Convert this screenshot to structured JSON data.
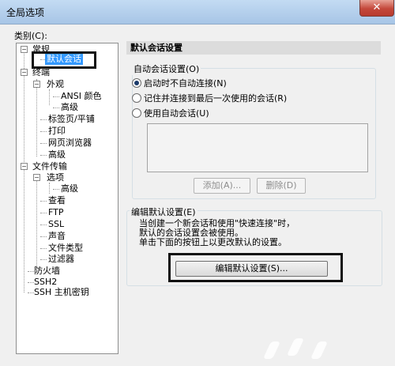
{
  "window": {
    "title": "全局选项",
    "close": "✕"
  },
  "category_label": "类别(C):",
  "tree": {
    "general": "常规",
    "default_session": "默认会话",
    "terminal": "终端",
    "appearance": "外观",
    "ansi_color": "ANSI 颜色",
    "advanced_1": "高级",
    "tabs": "标签页/平铺",
    "print": "打印",
    "web_browser": "网页浏览器",
    "advanced_2": "高级",
    "file_transfer": "文件传输",
    "options": "选项",
    "advanced_3": "高级",
    "view": "查看",
    "ftp": "FTP",
    "ssl": "SSL",
    "sound": "声音",
    "file_type": "文件类型",
    "filter": "过滤器",
    "firewall": "防火墙",
    "ssh2": "SSH2",
    "ssh_host_key": "SSH 主机密钥",
    "expanded_symbol": "−"
  },
  "panel": {
    "header": "默认会话设置",
    "auto_session": {
      "title": "自动会话设置(O)",
      "options": [
        {
          "label": "启动时不自动连接(N)",
          "checked": true
        },
        {
          "label": "记住并连接到最后一次使用的会话(R)",
          "checked": false
        },
        {
          "label": "使用自动会话(U)",
          "checked": false
        }
      ],
      "add_button": "添加(A)...",
      "delete_button": "删除(D)"
    },
    "edit_default": {
      "title": "编辑默认设置(E)",
      "description": [
        "当创建一个新会话和使用\"快速连接\"时，",
        "默认的会话设置会被使用。",
        "单击下面的按钮上以更改默认的设置。"
      ],
      "button": "编辑默认设置(S)..."
    }
  }
}
